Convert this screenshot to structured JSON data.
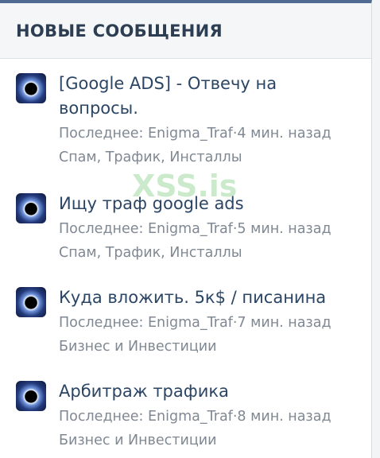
{
  "widget": {
    "title": "НОВЫЕ СООБЩЕНИЯ"
  },
  "watermark": "XSS.is",
  "threads": [
    {
      "title": "[Google ADS] - Отвечу на вопросы.",
      "last_prefix": "Последнее:",
      "last_user": "Enigma_Traf",
      "separator": "·",
      "time": "4 мин. назад",
      "forum": "Спам, Трафик, Инсталлы"
    },
    {
      "title": "Ищу траф google ads",
      "last_prefix": "Последнее:",
      "last_user": "Enigma_Traf",
      "separator": "·",
      "time": "5 мин. назад",
      "forum": "Спам, Трафик, Инсталлы"
    },
    {
      "title": "Куда вложить. 5к$ / писанина",
      "last_prefix": "Последнее:",
      "last_user": "Enigma_Traf",
      "separator": "·",
      "time": "7 мин. назад",
      "forum": "Бизнес и Инвестиции"
    },
    {
      "title": "Арбитраж трафика",
      "last_prefix": "Последнее:",
      "last_user": "Enigma_Traf",
      "separator": "·",
      "time": "8 мин. назад",
      "forum": "Бизнес и Инвестиции"
    }
  ]
}
